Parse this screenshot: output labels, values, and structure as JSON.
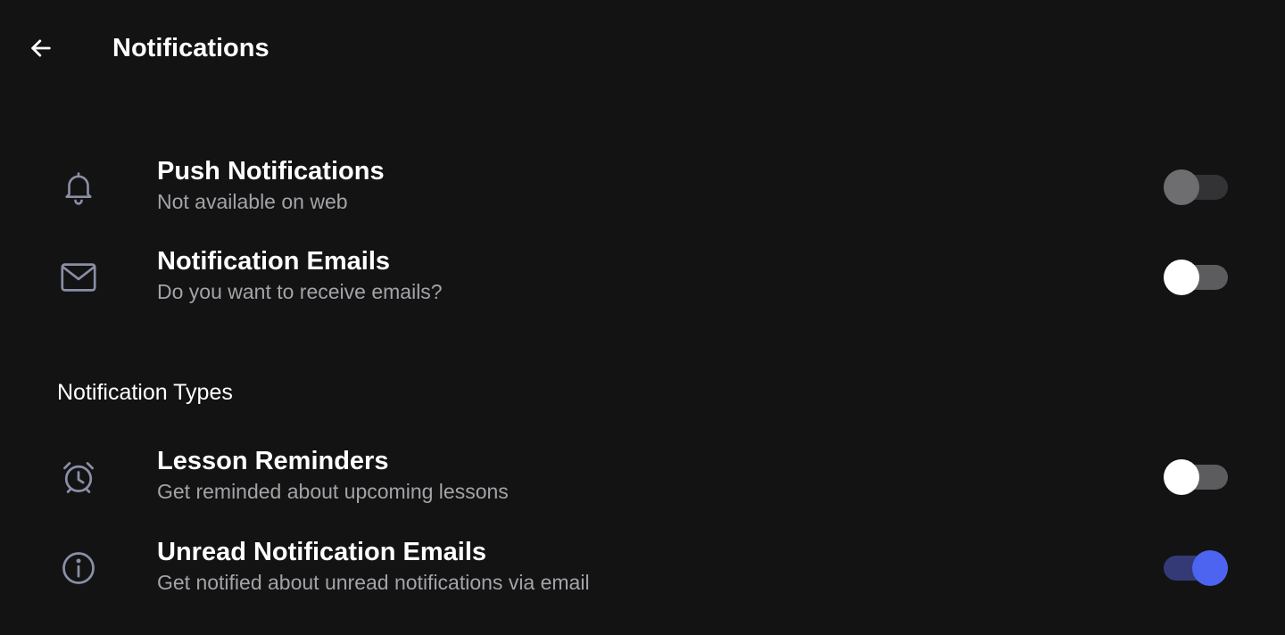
{
  "header": {
    "title": "Notifications",
    "back_icon": "arrow-left-icon"
  },
  "general": {
    "items": [
      {
        "icon": "bell-icon",
        "title": "Push Notifications",
        "subtitle": "Not available on web",
        "enabled": false,
        "disabled": true
      },
      {
        "icon": "envelope-icon",
        "title": "Notification Emails",
        "subtitle": "Do you want to receive emails?",
        "enabled": false,
        "disabled": false
      }
    ]
  },
  "types": {
    "title": "Notification Types",
    "items": [
      {
        "icon": "alarm-clock-icon",
        "title": "Lesson Reminders",
        "subtitle": "Get reminded about upcoming lessons",
        "enabled": false,
        "disabled": false
      },
      {
        "icon": "info-icon",
        "title": "Unread Notification Emails",
        "subtitle": "Get notified about unread notifications via email",
        "enabled": true,
        "disabled": false
      }
    ]
  },
  "colors": {
    "background": "#131314",
    "accent": "#4c64f0",
    "icon": "#8a8fa6",
    "subtitle": "#a3a3a8"
  }
}
